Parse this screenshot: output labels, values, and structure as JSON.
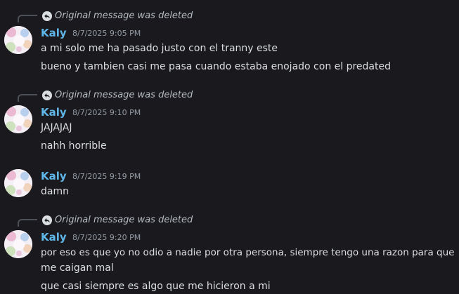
{
  "theme": {
    "background": "#1a1a1e",
    "username_color": "#5fb6e8",
    "text_color": "#dbdee1",
    "muted_color": "#949ba4"
  },
  "messages": [
    {
      "reply_text": "Original message was deleted",
      "author": "Kaly",
      "timestamp": "8/7/2025 9:05 PM",
      "lines": [
        "a mi solo me ha pasado justo con el tranny este",
        "bueno y tambien casi me pasa cuando estaba enojado con el predated"
      ]
    },
    {
      "reply_text": "Original message was deleted",
      "author": "Kaly",
      "timestamp": "8/7/2025 9:10 PM",
      "lines": [
        "JAJAJAJ",
        "nahh horrible"
      ]
    },
    {
      "author": "Kaly",
      "timestamp": "8/7/2025 9:19 PM",
      "lines": [
        "damn"
      ]
    },
    {
      "reply_text": "Original message was deleted",
      "author": "Kaly",
      "timestamp": "8/7/2025 9:20 PM",
      "lines": [
        "por eso es que yo no odio a nadie por otra persona, siempre tengo una razon para que",
        "me caigan mal",
        "que casi siempre es algo que me hicieron a mi"
      ]
    }
  ]
}
